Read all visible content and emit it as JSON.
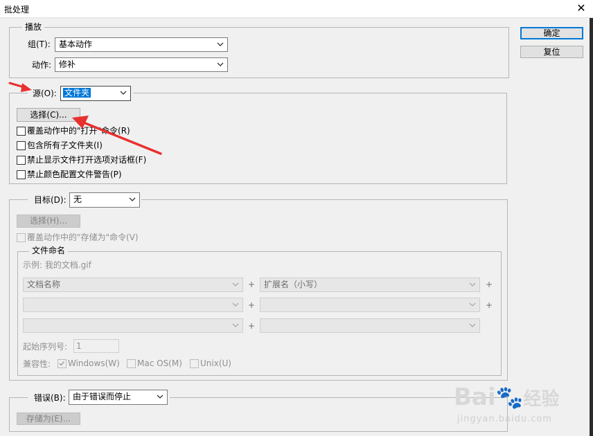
{
  "window": {
    "title": "批处理"
  },
  "buttons": {
    "ok": "确定",
    "reset": "复位"
  },
  "play": {
    "legend": "播放",
    "group_label": "组(T):",
    "group_value": "基本动作",
    "action_label": "动作:",
    "action_value": "修补"
  },
  "source": {
    "label": "源(O):",
    "value": "文件夹",
    "choose_button": "选择(C)...",
    "options": [
      "覆盖动作中的\"打开\"命令(R)",
      "包含所有子文件夹(I)",
      "禁止显示文件打开选项对话框(F)",
      "禁止颜色配置文件警告(P)"
    ]
  },
  "destination": {
    "label": "目标(D):",
    "value": "无",
    "choose_button": "选择(H)...",
    "override_save": "覆盖动作中的\"存储为\"命令(V)",
    "naming": {
      "legend": "文件命名",
      "example": "示例: 我的文档.gif",
      "rows": [
        [
          "文档名称",
          "扩展名（小写）"
        ],
        [
          "",
          ""
        ],
        [
          "",
          ""
        ]
      ],
      "plus": "+",
      "start_serial_label": "起始序列号:",
      "start_serial_value": "1",
      "compat_label": "兼容性:",
      "compat": [
        {
          "label": "Windows(W)",
          "checked": true
        },
        {
          "label": "Mac OS(M)",
          "checked": false
        },
        {
          "label": "Unix(U)",
          "checked": false
        }
      ]
    }
  },
  "errors": {
    "label": "错误(B):",
    "value": "由于错误而停止",
    "save_as_button": "存储为(E)..."
  },
  "watermark": {
    "brand": "Bai",
    "suffix": "经验",
    "url": "jingyan.baidu.com"
  },
  "colors": {
    "annotation_arrow": "#e8302f",
    "focus_blue": "#0078d7"
  }
}
